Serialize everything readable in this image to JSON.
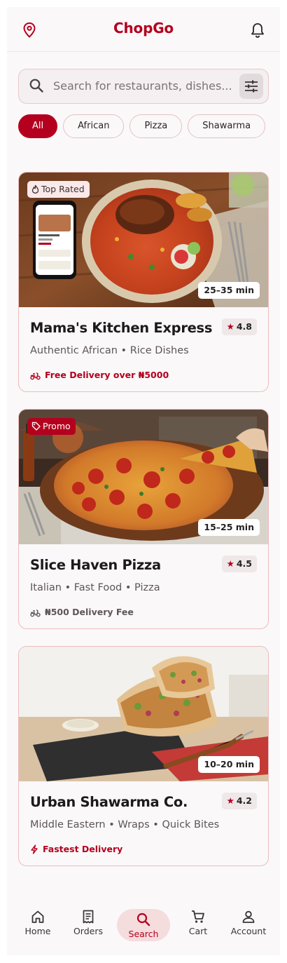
{
  "app": {
    "title": "ChopGo"
  },
  "search": {
    "placeholder": "Search for restaurants, dishes..."
  },
  "categories": [
    {
      "label": "All",
      "active": true
    },
    {
      "label": "African",
      "active": false
    },
    {
      "label": "Pizza",
      "active": false
    },
    {
      "label": "Shawarma",
      "active": false
    }
  ],
  "restaurants": [
    {
      "badge": "Top Rated",
      "badge_icon": "flame-icon",
      "time": "25–35 min",
      "name": "Mama's Kitchen Express",
      "rating": "4.8",
      "tags": "Authentic African • Rice Dishes",
      "delivery": "Free Delivery over ₦5000",
      "delivery_icon": "scooter-icon",
      "image": "jollof-rice-chicken-plate-photo"
    },
    {
      "badge": "Promo",
      "badge_icon": "tag-icon",
      "time": "15–25 min",
      "name": "Slice Haven Pizza",
      "rating": "4.5",
      "tags": "Italian • Fast Food • Pizza",
      "delivery": "₦500 Delivery Fee",
      "delivery_icon": "scooter-icon",
      "image": "pepperoni-pizza-photo"
    },
    {
      "time": "10–20 min",
      "name": "Urban Shawarma Co.",
      "rating": "4.2",
      "tags": "Middle Eastern • Wraps • Quick Bites",
      "delivery": "Fastest Delivery",
      "delivery_icon": "bolt-icon",
      "image": "shawarma-wraps-photo"
    }
  ],
  "nav": [
    {
      "label": "Home",
      "icon": "home-icon",
      "active": false
    },
    {
      "label": "Orders",
      "icon": "receipt-icon",
      "active": false
    },
    {
      "label": "Search",
      "icon": "search-icon",
      "active": true
    },
    {
      "label": "Cart",
      "icon": "cart-icon",
      "active": false
    },
    {
      "label": "Account",
      "icon": "person-icon",
      "active": false
    }
  ],
  "colors": {
    "accent": "#b4001e",
    "background": "#fbf8f9"
  }
}
